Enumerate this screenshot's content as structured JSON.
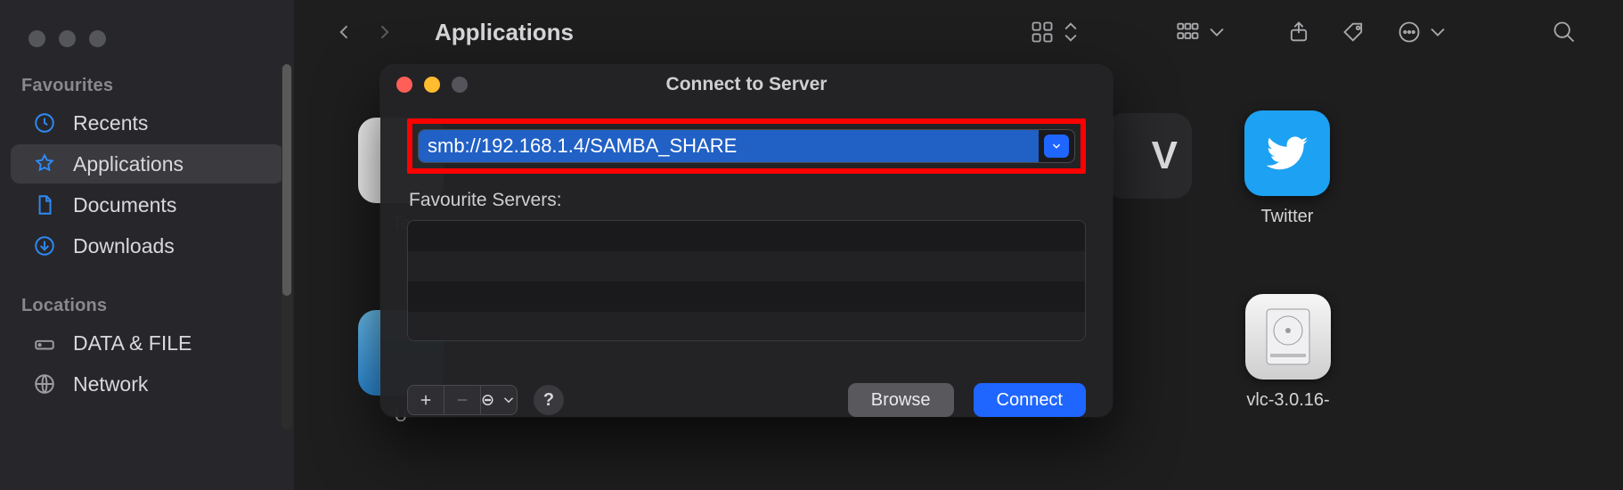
{
  "finder": {
    "title": "Applications",
    "sidebar": {
      "sections": [
        {
          "title": "Favourites",
          "items": [
            {
              "label": "Recents",
              "icon": "clock-icon"
            },
            {
              "label": "Applications",
              "icon": "apps-icon",
              "selected": true
            },
            {
              "label": "Documents",
              "icon": "document-icon"
            },
            {
              "label": "Downloads",
              "icon": "download-icon"
            }
          ]
        },
        {
          "title": "Locations",
          "items": [
            {
              "label": "DATA & FILE",
              "icon": "drive-icon"
            },
            {
              "label": "Network",
              "icon": "globe-icon"
            }
          ]
        }
      ]
    },
    "apps": {
      "textedit": {
        "label": "Te"
      },
      "tv": {
        "letter": "V"
      },
      "folder": {
        "label": "U"
      },
      "twitter": {
        "label": "Twitter"
      },
      "vlc": {
        "label": "vlc-3.0.16-"
      }
    }
  },
  "cts": {
    "title": "Connect to Server",
    "address": "smb://192.168.1.4/SAMBA_SHARE",
    "fav_label": "Favourite Servers:",
    "browse_label": "Browse",
    "connect_label": "Connect",
    "help_glyph": "?"
  }
}
